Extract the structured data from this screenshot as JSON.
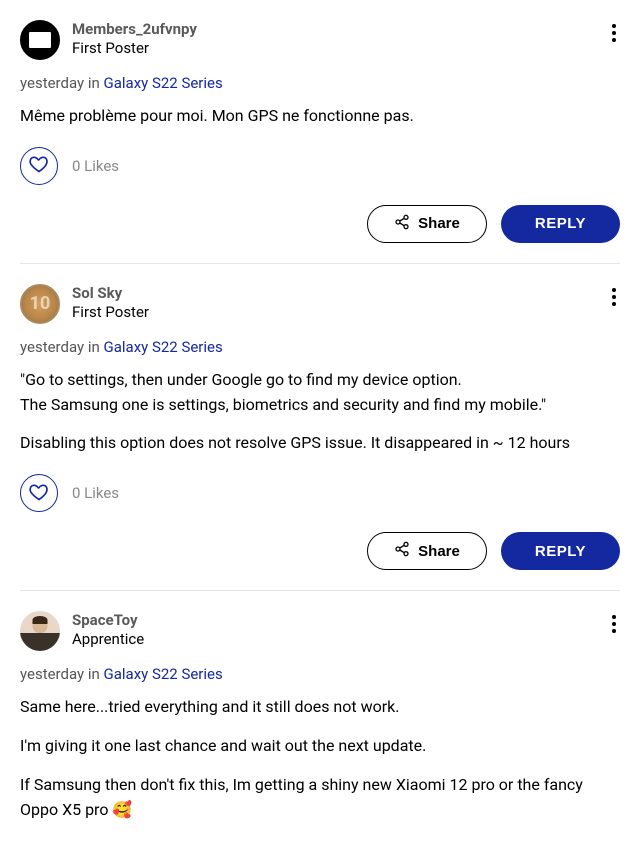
{
  "common": {
    "meta_in": "in",
    "share_label": "Share",
    "reply_label": "REPLY"
  },
  "posts": [
    {
      "username": "Members_2ufvnpy",
      "rank": "First Poster",
      "time": "yesterday",
      "category": "Galaxy S22 Series",
      "body": [
        "Même problème pour moi. Mon GPS ne fonctionne pas."
      ],
      "likes": "0 Likes",
      "show_actions": true,
      "avatar_kind": "black"
    },
    {
      "username": "Sol Sky",
      "rank": "First Poster",
      "time": "yesterday",
      "category": "Galaxy S22 Series",
      "body": [
        "\"Go to settings, then under Google go to find my device option.\nThe Samsung one is settings, biometrics and security and find my mobile.\"",
        "Disabling this option does not resolve GPS issue. It disappeared in ~ 12 hours"
      ],
      "likes": "0 Likes",
      "show_actions": true,
      "avatar_kind": "ten",
      "avatar_text": "10"
    },
    {
      "username": "SpaceToy",
      "rank": "Apprentice",
      "time": "yesterday",
      "category": "Galaxy S22 Series",
      "body": [
        "Same here...tried everything and it still does not work.",
        "I'm giving it one last chance and wait out the next update.",
        "If Samsung then don't fix this, Im getting a shiny new Xiaomi 12 pro or the fancy Oppo X5 pro 🥰"
      ],
      "likes": "0 Likes",
      "show_actions": false,
      "avatar_kind": "suit"
    }
  ]
}
